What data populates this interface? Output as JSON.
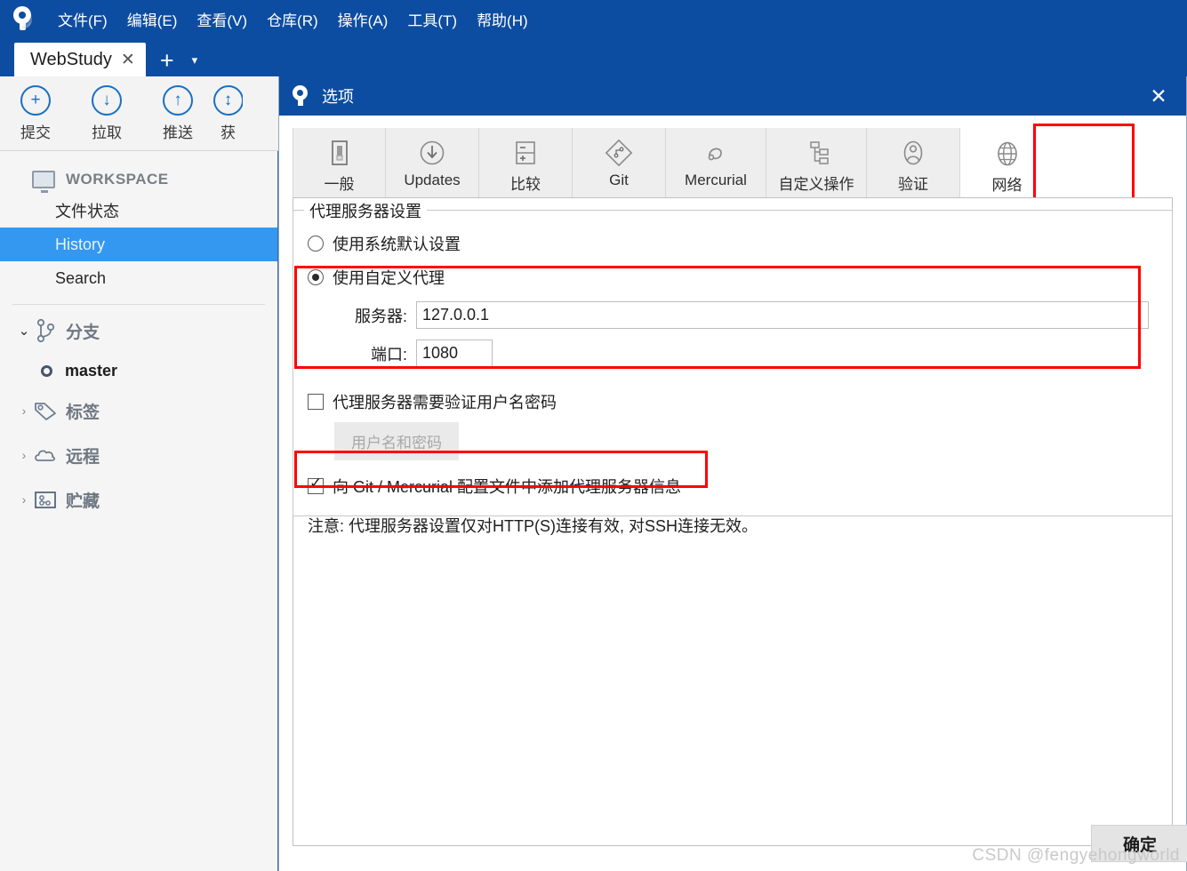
{
  "app": {
    "logo_icon": "sourcetree-logo-icon",
    "menu": [
      {
        "label": "文件(F)"
      },
      {
        "label": "编辑(E)"
      },
      {
        "label": "查看(V)"
      },
      {
        "label": "仓库(R)"
      },
      {
        "label": "操作(A)"
      },
      {
        "label": "工具(T)"
      },
      {
        "label": "帮助(H)"
      }
    ],
    "tab": {
      "label": "WebStudy",
      "close_icon": "close-icon",
      "new_tab_icon": "plus-icon",
      "tab_menu_icon": "chevron-down-icon"
    }
  },
  "toolbar": {
    "buttons": [
      {
        "label": "提交",
        "icon": "plus-circle-icon",
        "glyph": "+"
      },
      {
        "label": "拉取",
        "icon": "arrow-down-circle-icon",
        "glyph": "↓"
      },
      {
        "label": "推送",
        "icon": "arrow-up-circle-icon",
        "glyph": "↑"
      },
      {
        "label": "获",
        "icon": "fetch-circle-icon",
        "glyph": "↕"
      }
    ]
  },
  "sidebar": {
    "workspace_label": "WORKSPACE",
    "workspace_icon": "monitor-icon",
    "nav": [
      {
        "label": "文件状态",
        "selected": false
      },
      {
        "label": "History",
        "selected": true
      },
      {
        "label": "Search",
        "selected": false
      }
    ],
    "groups": [
      {
        "label": "分支",
        "icon": "branch-icon",
        "expanded": true
      },
      {
        "label": "标签",
        "icon": "tag-icon",
        "expanded": false
      },
      {
        "label": "远程",
        "icon": "cloud-icon",
        "expanded": false
      },
      {
        "label": "贮藏",
        "icon": "stash-icon",
        "expanded": false
      }
    ],
    "branches": [
      {
        "label": "master"
      }
    ]
  },
  "dialog": {
    "title": "选项",
    "title_icon": "sourcetree-logo-icon",
    "close_icon": "close-icon",
    "tabs": [
      {
        "label": "一般",
        "icon": "switch-icon",
        "active": false
      },
      {
        "label": "Updates",
        "icon": "download-circle-icon",
        "active": false
      },
      {
        "label": "比较",
        "icon": "diff-icon",
        "active": false
      },
      {
        "label": "Git",
        "icon": "git-diamond-icon",
        "active": false
      },
      {
        "label": "Mercurial",
        "icon": "mercurial-icon",
        "active": false
      },
      {
        "label": "自定义操作",
        "icon": "custom-actions-icon",
        "active": false
      },
      {
        "label": "验证",
        "icon": "user-circle-icon",
        "active": false
      },
      {
        "label": "网络",
        "icon": "globe-icon",
        "active": true
      }
    ],
    "proxy_group": {
      "title": "代理服务器设置",
      "option_system": {
        "label": "使用系统默认设置",
        "selected": false
      },
      "option_custom": {
        "label": "使用自定义代理",
        "selected": true
      },
      "server": {
        "label": "服务器:",
        "value": "127.0.0.1"
      },
      "port": {
        "label": "端口:",
        "value": "1080"
      },
      "auth_checkbox": {
        "label": "代理服务器需要验证用户名密码",
        "checked": false
      },
      "credentials_button": {
        "label": "用户名和密码",
        "disabled": true
      },
      "config_checkbox": {
        "label": "向 Git / Mercurial 配置文件中添加代理服务器信息",
        "checked": true
      },
      "note": "注意: 代理服务器设置仅对HTTP(S)连接有效, 对SSH连接无效。"
    },
    "ok_button": {
      "label": "确定"
    }
  },
  "watermark": {
    "text": "CSDN @fengyehongworld"
  },
  "colors": {
    "title_blue": "#0D4DA1",
    "selection_blue": "#3498f0",
    "highlight_red": "#ff0000",
    "toolbar_icon_blue": "#1a6fc4"
  }
}
